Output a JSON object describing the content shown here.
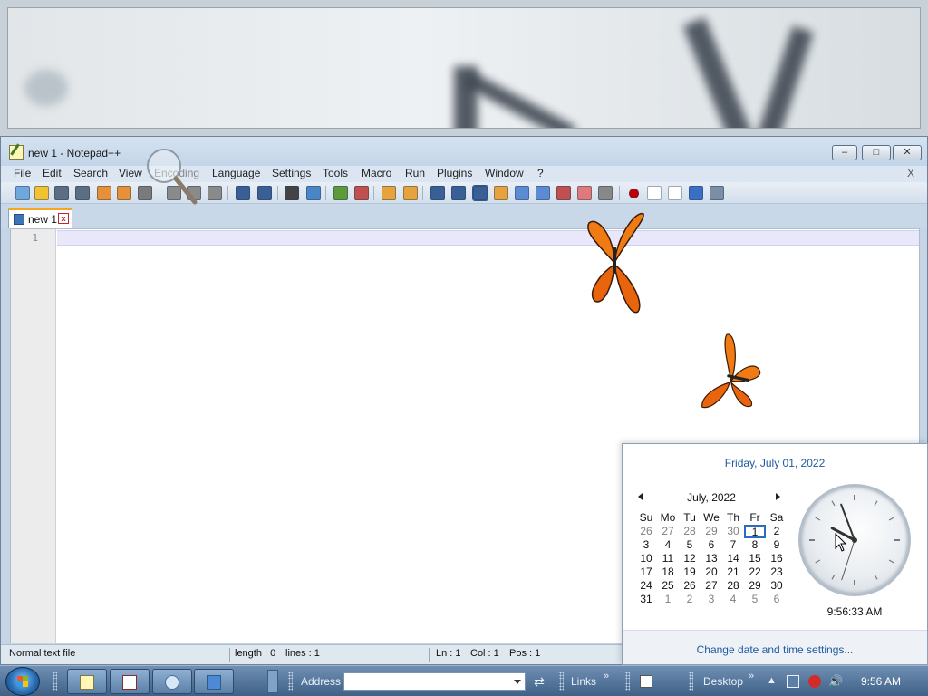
{
  "window": {
    "title": "new 1 - Notepad++",
    "close_doc": "X"
  },
  "menu": [
    "File",
    "Edit",
    "Search",
    "View",
    "Encoding",
    "Language",
    "Settings",
    "Tools",
    "Macro",
    "Run",
    "Plugins",
    "Window",
    "?"
  ],
  "tab": {
    "label": "new 1",
    "close": "x"
  },
  "editor": {
    "line_number": "1"
  },
  "status": {
    "file_type": "Normal text file",
    "length": "length : 0",
    "lines": "lines : 1",
    "ln": "Ln : 1",
    "col": "Col : 1",
    "pos": "Pos : 1"
  },
  "flyout": {
    "date": "Friday, July 01, 2022",
    "month": "July, 2022",
    "weekdays": [
      "Su",
      "Mo",
      "Tu",
      "We",
      "Th",
      "Fr",
      "Sa"
    ],
    "weeks": [
      [
        "26",
        "27",
        "28",
        "29",
        "30",
        "1",
        "2"
      ],
      [
        "3",
        "4",
        "5",
        "6",
        "7",
        "8",
        "9"
      ],
      [
        "10",
        "11",
        "12",
        "13",
        "14",
        "15",
        "16"
      ],
      [
        "17",
        "18",
        "19",
        "20",
        "21",
        "22",
        "23"
      ],
      [
        "24",
        "25",
        "26",
        "27",
        "28",
        "29",
        "30"
      ],
      [
        "31",
        "1",
        "2",
        "3",
        "4",
        "5",
        "6"
      ]
    ],
    "clock_time": "9:56:33 AM",
    "link": "Change date and time settings..."
  },
  "taskbar": {
    "address_label": "Address",
    "address_value": "",
    "links_label": "Links",
    "desktop_label": "Desktop",
    "chevron": "»",
    "time": "9:56 AM"
  },
  "colors": {
    "link_blue": "#1e5aa0",
    "current_line": "#e8e8fa",
    "taskbar": "#3f6186",
    "butterfly_orange": "#f07a14"
  },
  "icons": [
    "new-file-icon",
    "open-file-icon",
    "save-icon",
    "save-all-icon",
    "close-icon",
    "close-all-icon",
    "print-icon",
    "cut-icon",
    "copy-icon",
    "paste-icon",
    "undo-icon",
    "redo-icon",
    "find-icon",
    "replace-icon",
    "zoom-in-icon",
    "zoom-out-icon",
    "sync-v-icon",
    "sync-h-icon",
    "wrap-icon",
    "all-chars-icon",
    "indent-guide-icon",
    "udl-icon",
    "doc-map-icon",
    "doc-list-icon",
    "function-list-icon",
    "folder-workspace-icon",
    "monitor-icon",
    "record-macro-icon",
    "stop-macro-icon",
    "play-macro-icon",
    "run-macro-multiple-icon",
    "save-macro-icon"
  ]
}
